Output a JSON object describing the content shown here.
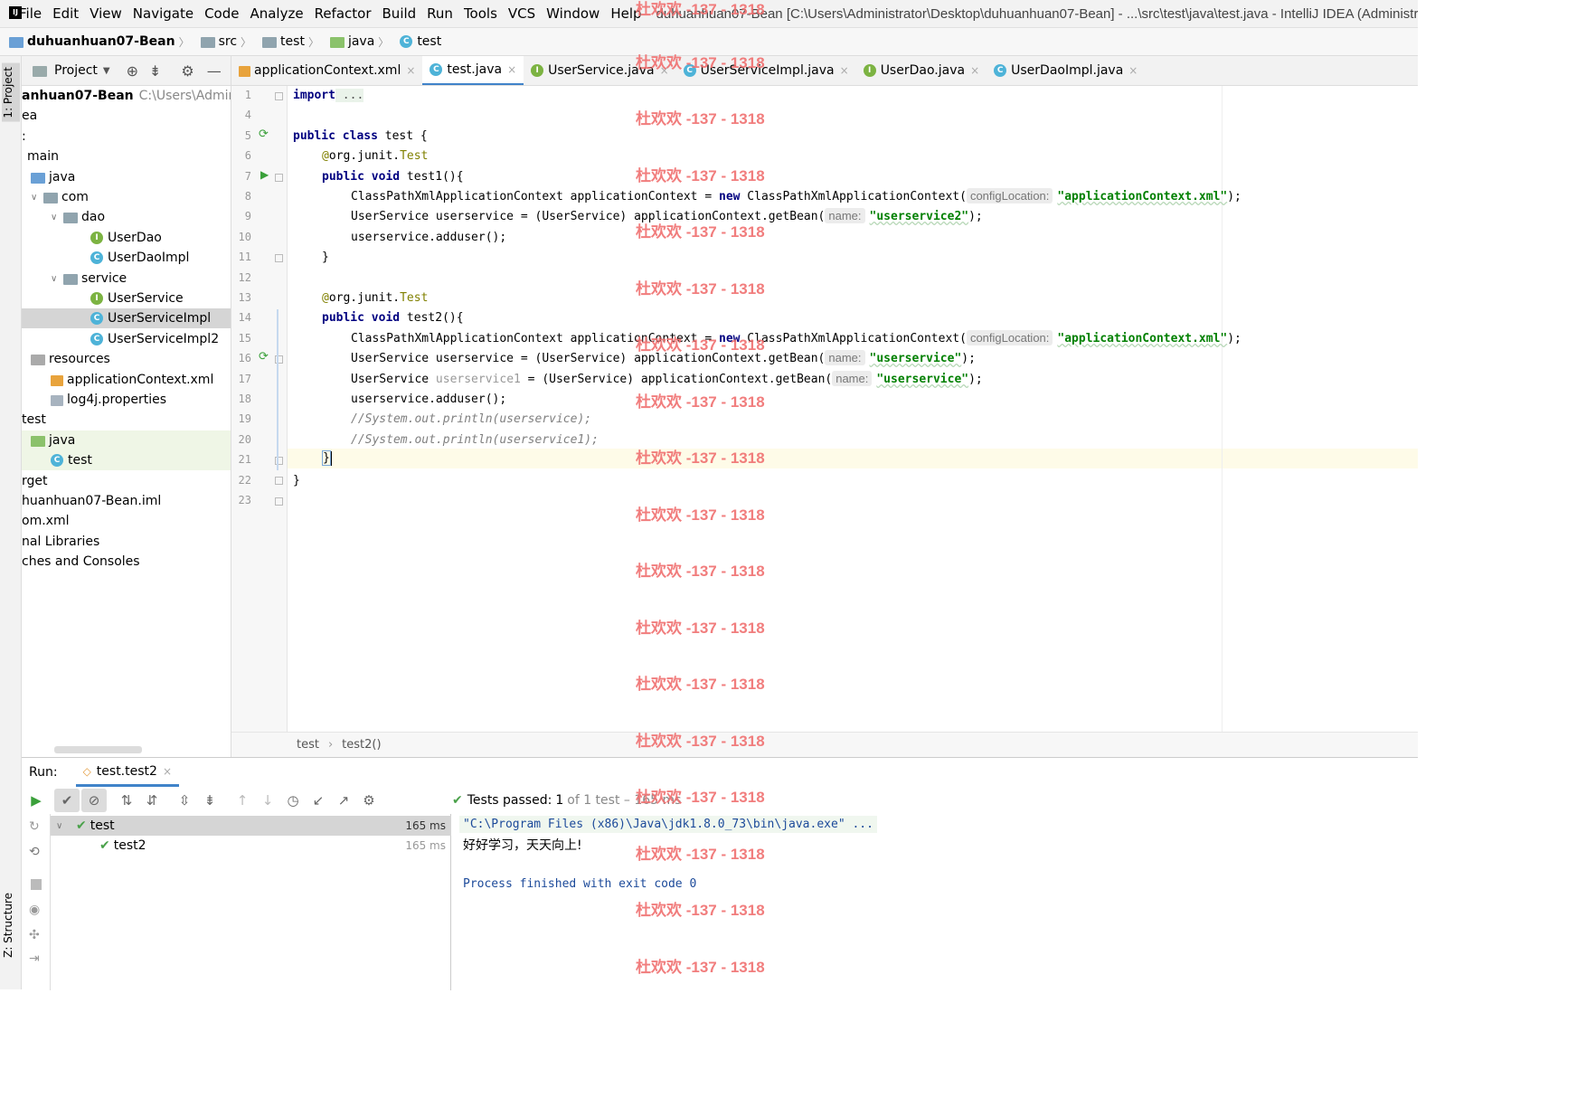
{
  "menubar": {
    "items": [
      "File",
      "Edit",
      "View",
      "Navigate",
      "Code",
      "Analyze",
      "Refactor",
      "Build",
      "Run",
      "Tools",
      "VCS",
      "Window",
      "Help"
    ],
    "title": "duhuanhuan07-Bean [C:\\Users\\Administrator\\Desktop\\duhuanhuan07-Bean] - ...\\src\\test\\java\\test.java - IntelliJ IDEA (Administrator)"
  },
  "breadcrumb": [
    "duhuanhuan07-Bean",
    "src",
    "test",
    "java",
    "test"
  ],
  "project_panel": {
    "title": "Project",
    "tree": [
      {
        "label": "anhuan07-Bean",
        "extra": "C:\\Users\\Administ",
        "bold": true
      },
      {
        "label": "ea"
      },
      {
        "label": ":"
      },
      {
        "label": "main"
      },
      {
        "label": "java"
      },
      {
        "label": "com"
      },
      {
        "label": "dao"
      },
      {
        "label": "UserDao"
      },
      {
        "label": "UserDaoImpl"
      },
      {
        "label": "service"
      },
      {
        "label": "UserService"
      },
      {
        "label": "UserServiceImpl"
      },
      {
        "label": "UserServiceImpl2"
      },
      {
        "label": "resources"
      },
      {
        "label": "applicationContext.xml"
      },
      {
        "label": "log4j.properties"
      },
      {
        "label": "test"
      },
      {
        "label": "java"
      },
      {
        "label": "test"
      },
      {
        "label": "rget"
      },
      {
        "label": "huanhuan07-Bean.iml"
      },
      {
        "label": "om.xml"
      },
      {
        "label": "nal Libraries"
      },
      {
        "label": "ches and Consoles"
      }
    ]
  },
  "left_tabs": {
    "project": "1: Project",
    "structure": "Z: Structure"
  },
  "editor": {
    "tabs": [
      "applicationContext.xml",
      "test.java",
      "UserService.java",
      "UserServiceImpl.java",
      "UserDao.java",
      "UserDaoImpl.java"
    ],
    "active_tab": "test.java",
    "line_numbers": [
      "1",
      "4",
      "5",
      "6",
      "7",
      "8",
      "9",
      "10",
      "11",
      "12",
      "13",
      "14",
      "15",
      "16",
      "17",
      "18",
      "19",
      "20",
      "21",
      "22",
      "23"
    ],
    "code": {
      "l1_kw": "import",
      "l1_rest": " ...",
      "l5_kw1": "public",
      "l5_kw2": "class",
      "l5_rest": " test {",
      "l6_ann": "@",
      "l6_text": "org.junit.",
      "l6_cls": "Test",
      "l7_kw1": "public",
      "l7_kw2": "void",
      "l7_rest": " test1(){",
      "l8_a": "ClassPathXmlApplicationContext applicationContext = ",
      "l8_kw": "new",
      "l8_b": " ClassPathXmlApplicationContext(",
      "l8_hint": "configLocation:",
      "l8_str": "\"applicationContext.xml\"",
      "l8_c": ");",
      "l9_a": "UserService userservice = (UserService) applicationContext.getBean(",
      "l9_hint": "name:",
      "l9_str": "\"userservice2\"",
      "l9_c": ");",
      "l10": "userservice.adduser();",
      "l11": "}",
      "l13_ann": "@",
      "l13_text": "org.junit.",
      "l13_cls": "Test",
      "l14_kw1": "public",
      "l14_kw2": "void",
      "l14_rest": " test2(){",
      "l15_a": "ClassPathXmlApplicationContext applicationContext = ",
      "l15_kw": "new",
      "l15_b": " ClassPathXmlApplicationContext(",
      "l15_hint": "configLocation:",
      "l15_str": "\"applicationContext.xml\"",
      "l15_c": ");",
      "l16_a": "UserService userservice = (UserService) applicationContext.getBean(",
      "l16_hint": "name:",
      "l16_str": "\"userservice\"",
      "l16_c": ");",
      "l17_a": "UserService ",
      "l17_unused": "userservice1",
      "l17_b": " = (UserService) applicationContext.getBean(",
      "l17_hint": "name:",
      "l17_str": "\"userservice\"",
      "l17_c": ");",
      "l18": "userservice.adduser();",
      "l19": "//System.out.println(userservice);",
      "l20": "//System.out.println(userservice1);",
      "l21": "}",
      "l22": "}"
    },
    "footer_crumbs": [
      "test",
      "test2()"
    ]
  },
  "run_panel": {
    "label": "Run:",
    "tab": "test.test2",
    "status_prefix": "Tests passed:",
    "status_count": "1",
    "status_suffix": "of 1 test – 165 ms",
    "tree": [
      {
        "label": "test",
        "time": "165 ms"
      },
      {
        "label": "test2",
        "time": "165 ms"
      }
    ],
    "output": {
      "cmd": "\"C:\\Program Files (x86)\\Java\\jdk1.8.0_73\\bin\\java.exe\" ...",
      "line1": "好好学习，天天向上!",
      "line2": "Process finished with exit code 0"
    }
  },
  "watermark": "杜欢欢 -137 - 1318",
  "colors": {
    "keyword": "#000080",
    "string": "#008000",
    "annotation": "#808000",
    "comment": "#808080",
    "accent": "#4083c9",
    "watermark": "#f07070"
  }
}
